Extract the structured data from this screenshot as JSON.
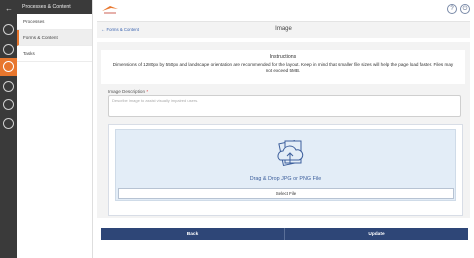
{
  "rail": {
    "icons": [
      "collapse-arrow-icon",
      "clock-icon",
      "document-icon",
      "folder-icon",
      "mail-icon",
      "globe-icon",
      "user-icon"
    ]
  },
  "subnav": {
    "header": "Processes & Content",
    "items": [
      {
        "label": "Processes",
        "active": false
      },
      {
        "label": "Forms & Content",
        "active": true
      },
      {
        "label": "Tasks",
        "active": false
      }
    ]
  },
  "topbar": {
    "help_icon": "?",
    "logout_icon": "⏻"
  },
  "page": {
    "breadcrumb": "← Forms & Content",
    "title": "Image"
  },
  "instructions": {
    "title": "Instructions",
    "text": "Dimensions of 1280px by 550px and landscape orientation are recommended for the layout. Keep in mind that smaller file sizes will help the page load faster. Files may not exceed 5MB."
  },
  "description": {
    "label": "Image Description",
    "required_mark": "*",
    "placeholder": "Describe image to assist visually impaired users.",
    "value": ""
  },
  "upload": {
    "drop_text": "Drag & Drop JPG or PNG File",
    "select_label": "Select File"
  },
  "footer": {
    "back_label": "Back",
    "update_label": "Update"
  },
  "colors": {
    "accent": "#e8772e",
    "navy": "#2e4677",
    "rail": "#3a3a3a",
    "dropzone": "#e3edf7"
  }
}
